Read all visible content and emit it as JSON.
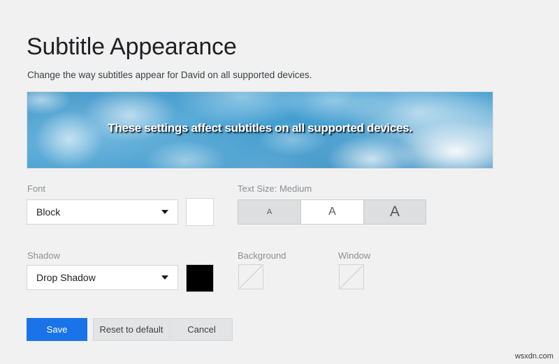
{
  "page": {
    "title": "Subtitle Appearance",
    "description": "Change the way subtitles appear for David on all supported devices."
  },
  "preview": {
    "subtitle_text": "These settings affect subtitles on all supported devices.",
    "background_image": "blue-sky-clouds",
    "text_color": "#ffffff",
    "shadow_color": "#000000"
  },
  "controls": {
    "font": {
      "label": "Font",
      "value": "Block",
      "color_swatch": "#ffffff"
    },
    "text_size": {
      "label": "Text Size: Medium",
      "selected": "Medium",
      "options": [
        {
          "name": "Small",
          "glyph": "A"
        },
        {
          "name": "Medium",
          "glyph": "A"
        },
        {
          "name": "Large",
          "glyph": "A"
        }
      ]
    },
    "shadow": {
      "label": "Shadow",
      "value": "Drop Shadow",
      "color_swatch": "#000000"
    },
    "background": {
      "label": "Background",
      "color_swatch": "none"
    },
    "window": {
      "label": "Window",
      "color_swatch": "none"
    }
  },
  "actions": {
    "save": "Save",
    "reset": "Reset to default",
    "cancel": "Cancel",
    "save_color": "#1a73e8"
  },
  "watermark": "wsxdn.com"
}
